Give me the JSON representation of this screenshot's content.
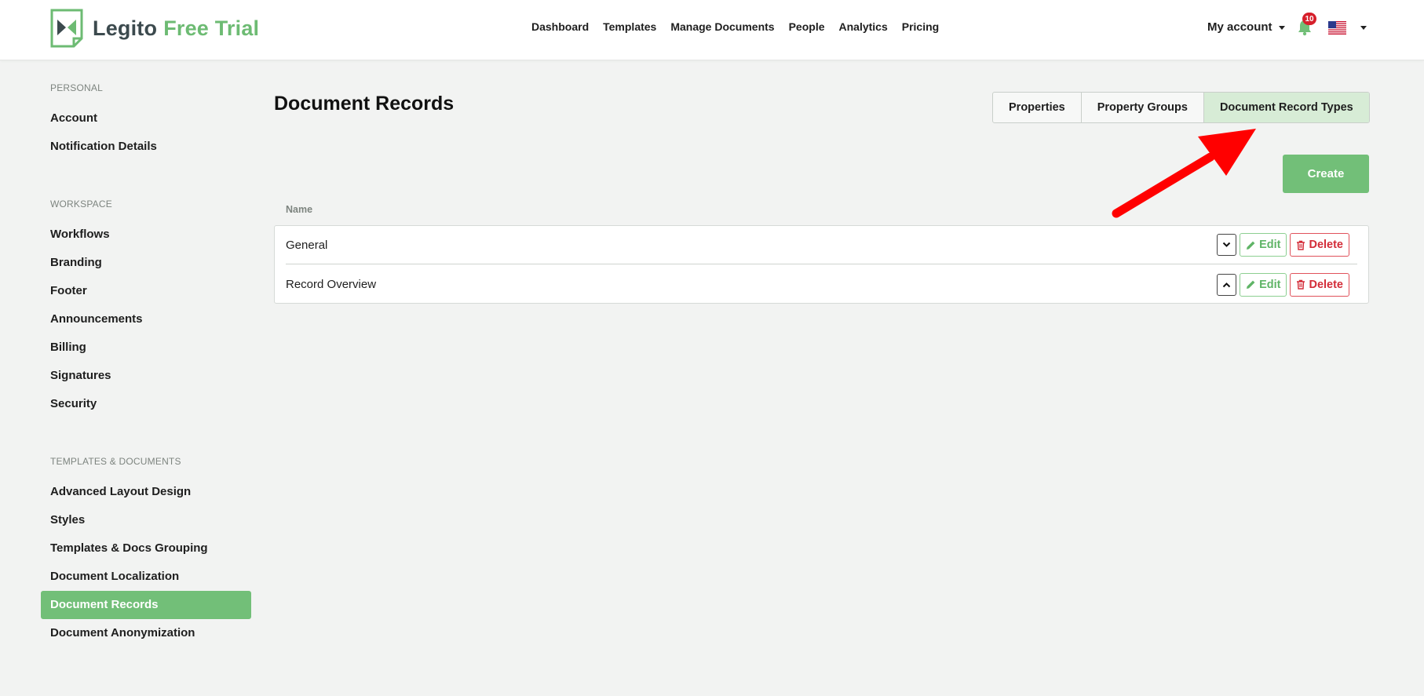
{
  "app": {
    "name": "Legito",
    "plan": "Free Trial",
    "brand_color": "#72bf78"
  },
  "nav": {
    "items": [
      "Dashboard",
      "Templates",
      "Manage Documents",
      "People",
      "Analytics",
      "Pricing"
    ],
    "account_label": "My account",
    "notification_count": "10",
    "language_flag": "us-flag-icon"
  },
  "sidebar": {
    "personal": {
      "title": "PERSONAL",
      "items": [
        "Account",
        "Notification Details"
      ]
    },
    "workspace": {
      "title": "WORKSPACE",
      "items": [
        "Workflows",
        "Branding",
        "Footer",
        "Announcements",
        "Billing",
        "Signatures",
        "Security"
      ]
    },
    "templates_documents": {
      "title": "TEMPLATES & DOCUMENTS",
      "items": [
        "Advanced Layout Design",
        "Styles",
        "Templates & Docs Grouping",
        "Document Localization",
        "Document Records",
        "Document Anonymization"
      ]
    },
    "active_item": "Document Records"
  },
  "main": {
    "title": "Document Records",
    "tabs": [
      "Properties",
      "Property Groups",
      "Document Record Types"
    ],
    "active_tab": "Document Record Types",
    "create_label": "Create",
    "column_name": "Name",
    "rows": [
      {
        "name": "General",
        "toggle": "chevron-down-icon",
        "edit_label": "Edit",
        "delete_label": "Delete"
      },
      {
        "name": "Record Overview",
        "toggle": "chevron-up-icon",
        "edit_label": "Edit",
        "delete_label": "Delete"
      }
    ]
  },
  "annotation": {
    "arrow_color": "#ff0000"
  }
}
